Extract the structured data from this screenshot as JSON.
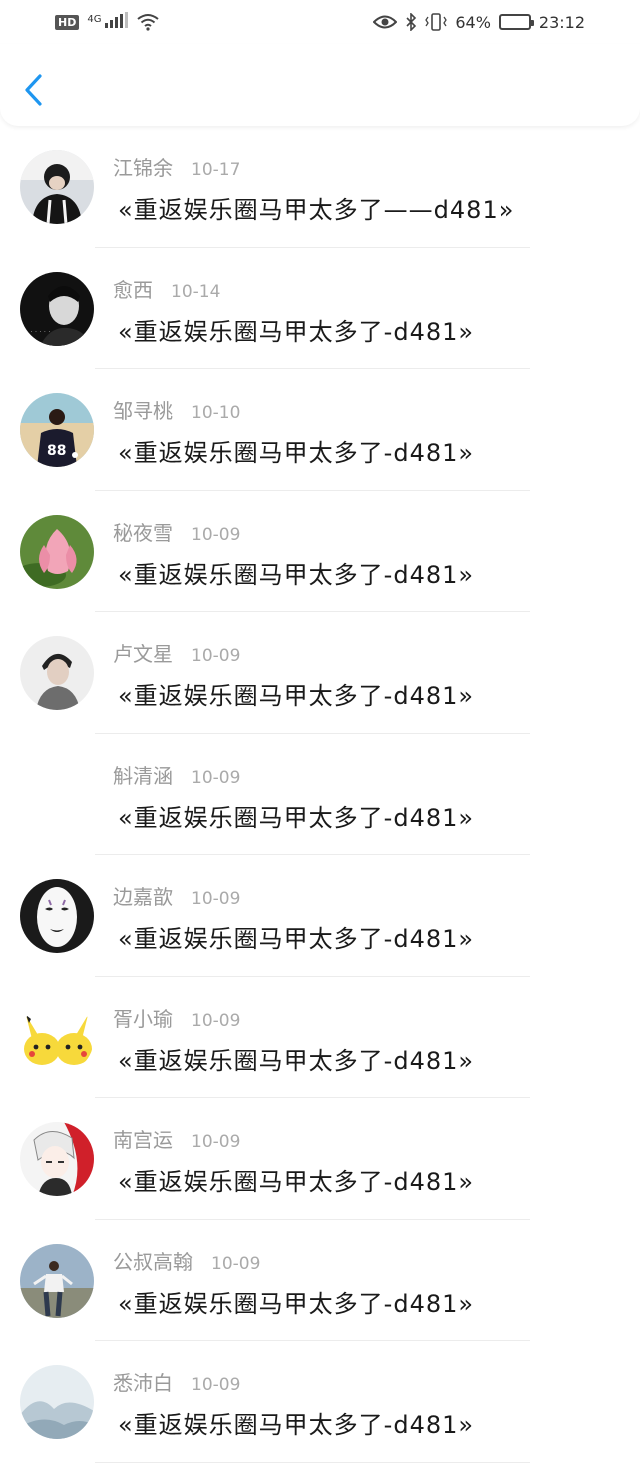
{
  "status_bar": {
    "hd_badge": "HD",
    "network": "4G",
    "battery_percent_text": "64%",
    "battery_level": 0.64,
    "time": "23:12",
    "icons": [
      "signal-icon",
      "wifi-icon",
      "eye-icon",
      "bluetooth-icon",
      "vibrate-icon"
    ]
  },
  "nav": {
    "back_icon": "chevron-left-icon",
    "accent": "#1e96f0"
  },
  "items": [
    {
      "name": "江锦余",
      "date": "10-17",
      "title": "«重返娱乐圈马甲太多了——d481»",
      "avatar": "boy-in-black"
    },
    {
      "name": "愈西",
      "date": "10-14",
      "title": "«重返娱乐圈马甲太多了-d481»",
      "avatar": "dark-portrait"
    },
    {
      "name": "邹寻桃",
      "date": "10-10",
      "title": "«重返娱乐圈马甲太多了-d481»",
      "avatar": "jersey-88-beach"
    },
    {
      "name": "秘夜雪",
      "date": "10-09",
      "title": "«重返娱乐圈马甲太多了-d481»",
      "avatar": "lotus"
    },
    {
      "name": "卢文星",
      "date": "10-09",
      "title": "«重返娱乐圈马甲太多了-d481»",
      "avatar": "grey-portrait"
    },
    {
      "name": "斛清涵",
      "date": "10-09",
      "title": "«重返娱乐圈马甲太多了-d481»",
      "avatar": "none"
    },
    {
      "name": "边嘉歆",
      "date": "10-09",
      "title": "«重返娱乐圈马甲太多了-d481»",
      "avatar": "no-face-mask"
    },
    {
      "name": "胥小瑜",
      "date": "10-09",
      "title": "«重返娱乐圈马甲太多了-d481»",
      "avatar": "pikachu"
    },
    {
      "name": "南宫运",
      "date": "10-09",
      "title": "«重返娱乐圈马甲太多了-d481»",
      "avatar": "anime-red"
    },
    {
      "name": "公叔高翰",
      "date": "10-09",
      "title": "«重返娱乐圈马甲太多了-d481»",
      "avatar": "man-standing"
    },
    {
      "name": "悉沛白",
      "date": "10-09",
      "title": "«重返娱乐圈马甲太多了-d481»",
      "avatar": "misty-landscape"
    }
  ]
}
